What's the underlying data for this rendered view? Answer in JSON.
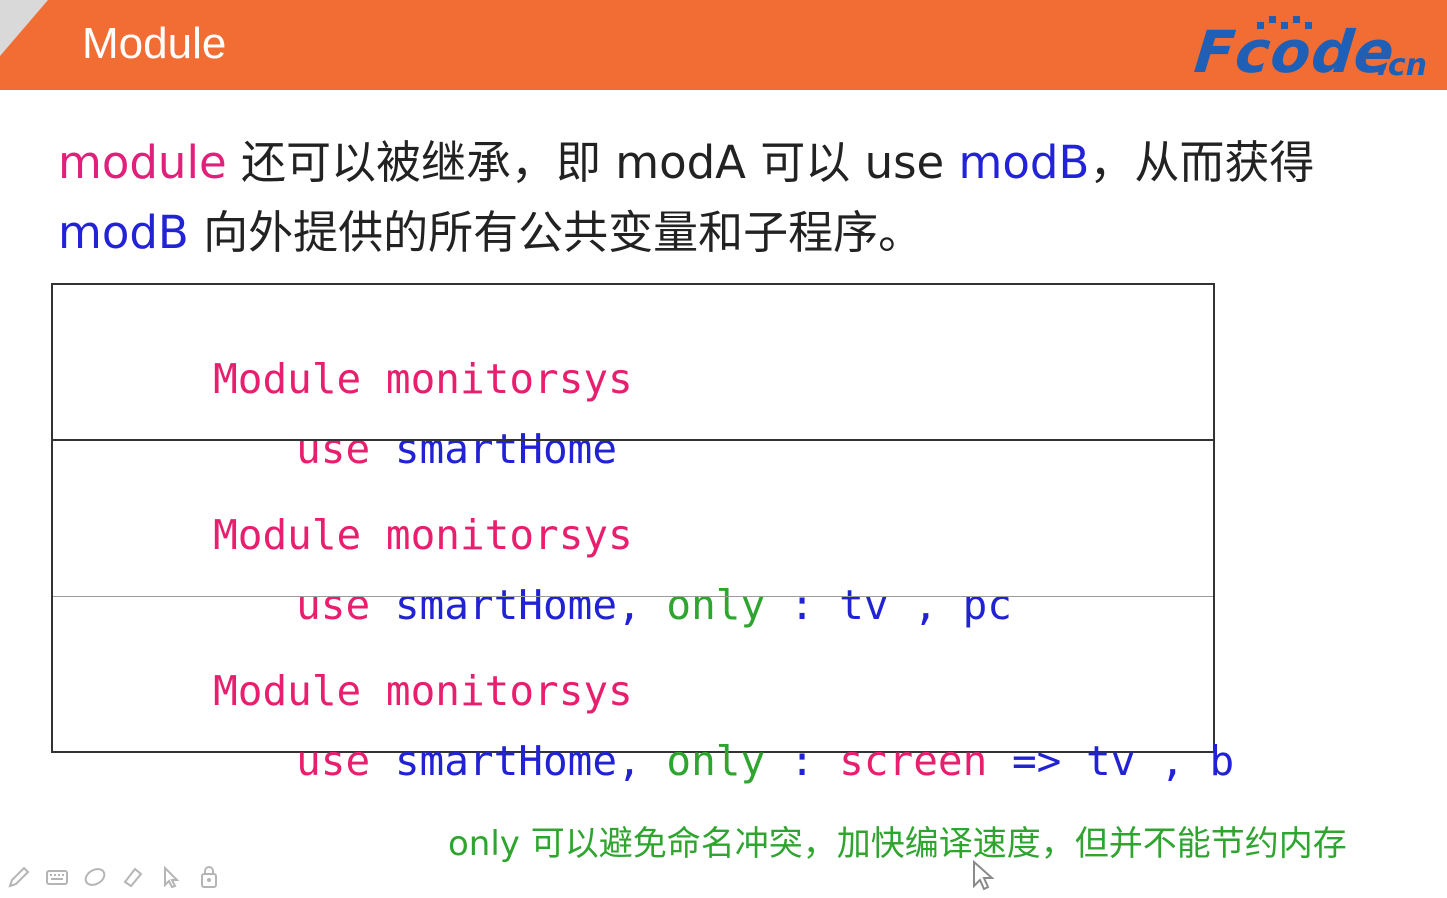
{
  "header": {
    "title": "Module",
    "logo_text": "Fcode",
    "logo_suffix": ".cn",
    "brand_color": "#f26d33",
    "logo_color": "#1f5fb5"
  },
  "description": {
    "line1": {
      "part1": "module",
      "part2": " 还可以被继承，即 modA 可以 use ",
      "part3": "modB",
      "part4": "，从而获得"
    },
    "line2": {
      "part1": "modB",
      "part2": " 向外提供的所有公共变量和子程序。"
    }
  },
  "code_blocks": [
    {
      "line1": {
        "kw": "Module",
        "name": " monitorsys"
      },
      "line2": {
        "kw": "use",
        "name": " smartHome"
      }
    },
    {
      "line1": {
        "kw": "Module",
        "name": " monitorsys"
      },
      "line2": {
        "kw": "use",
        "name": " smartHome",
        "comma": ",",
        "only": " only",
        "colon": " :",
        "rest1": " tv",
        "comma2": " ,",
        "rest2": " pc"
      }
    },
    {
      "line1": {
        "kw": "Module",
        "name": " monitorsys"
      },
      "line2": {
        "kw": "use",
        "name": " smartHome",
        "comma": ",",
        "only": " only",
        "colon": " :",
        "local": " screen",
        "arrow": " =>",
        "rest1": " tv",
        "comma2": " ,",
        "rest2": " b"
      }
    }
  ],
  "note": "only 可以避免命名冲突，加快编译速度，但并不能节约内存",
  "toolbar": {
    "icons": [
      "pen-icon",
      "keyboard-icon",
      "eraser-icon",
      "highlighter-icon",
      "pointer-icon",
      "lock-icon"
    ]
  }
}
